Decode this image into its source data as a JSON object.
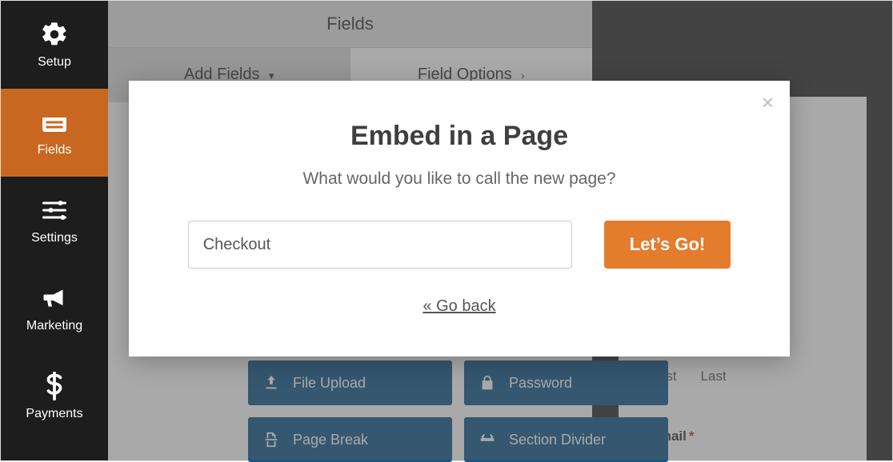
{
  "sidebar": {
    "items": [
      {
        "label": "Setup",
        "icon": "gear-icon"
      },
      {
        "label": "Fields",
        "icon": "form-icon",
        "active": true
      },
      {
        "label": "Settings",
        "icon": "sliders-icon"
      },
      {
        "label": "Marketing",
        "icon": "megaphone-icon"
      },
      {
        "label": "Payments",
        "icon": "dollar-icon"
      }
    ]
  },
  "header": {
    "title": "Fields"
  },
  "tabs": [
    {
      "label": "Add Fields"
    },
    {
      "label": "Field Options"
    }
  ],
  "field_buttons": [
    {
      "label": "File Upload",
      "icon": "upload-icon"
    },
    {
      "label": "Password",
      "icon": "lock-icon"
    },
    {
      "label": "Page Break",
      "icon": "pagebreak-icon"
    },
    {
      "label": "Section Divider",
      "icon": "divider-icon"
    }
  ],
  "preview": {
    "first_label": "First",
    "last_label": "Last",
    "email_label": "Email"
  },
  "modal": {
    "title": "Embed in a Page",
    "subtitle": "What would you like to call the new page?",
    "input_value": "Checkout",
    "submit_label": "Let’s Go!",
    "back_label": "« Go back",
    "close_glyph": "×"
  }
}
